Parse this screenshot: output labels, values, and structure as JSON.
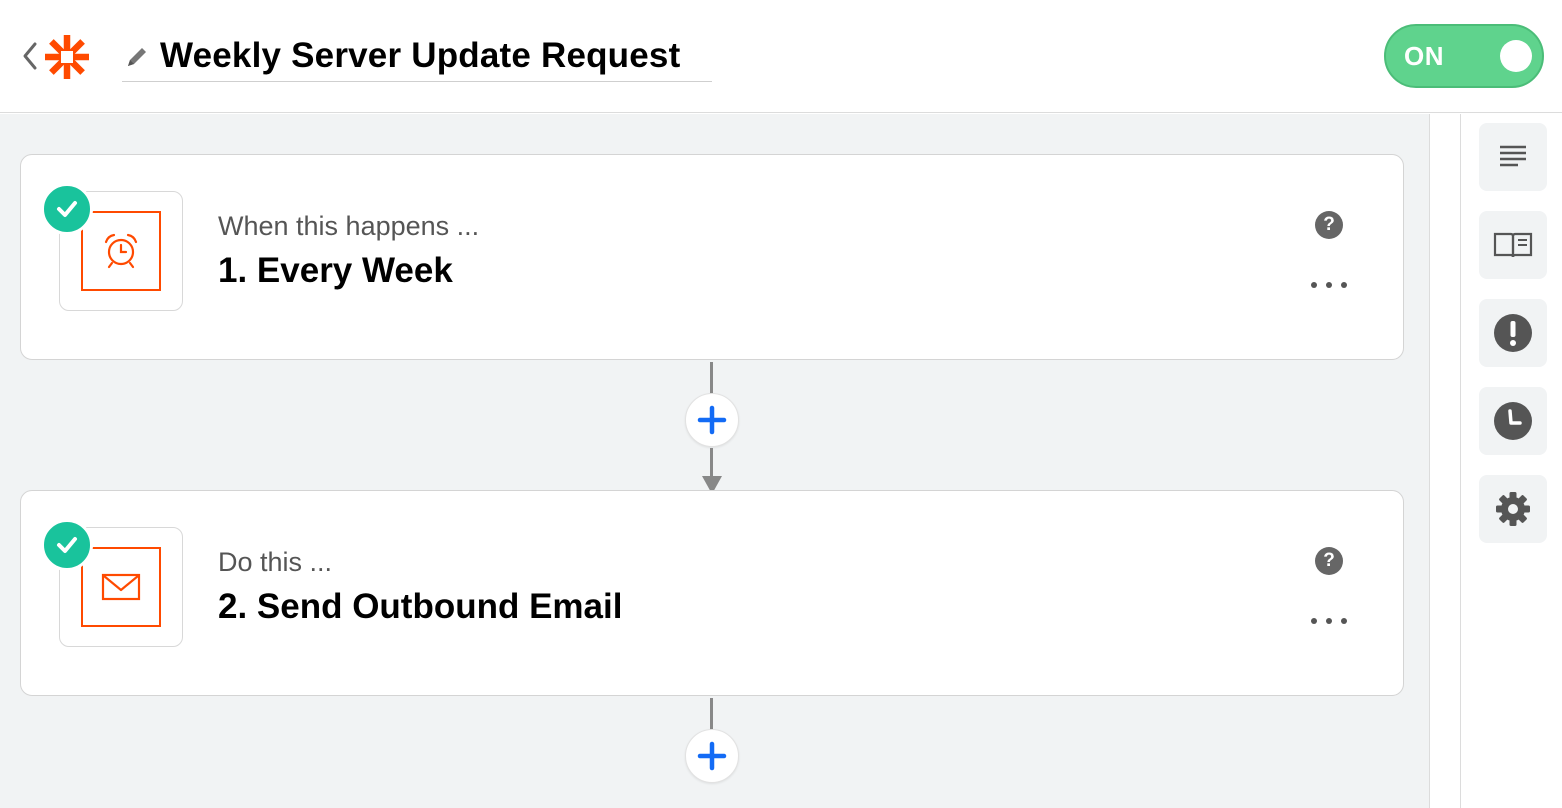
{
  "header": {
    "title": "Weekly Server Update Request",
    "toggle_label": "ON"
  },
  "steps": [
    {
      "subtitle": "When this happens ...",
      "title": "1. Every Week",
      "app_icon": "alarm-clock-icon"
    },
    {
      "subtitle": "Do this ...",
      "title": "2. Send Outbound Email",
      "app_icon": "envelope-icon"
    }
  ],
  "sidebar": {
    "items": [
      "details-icon",
      "guide-book-icon",
      "alert-icon",
      "history-icon",
      "settings-icon"
    ]
  },
  "colors": {
    "brand": "#ff4a00",
    "toggle_on": "#5fd38d",
    "check": "#19c39c",
    "add_step": "#136bf5",
    "canvas": "#f1f3f4"
  }
}
